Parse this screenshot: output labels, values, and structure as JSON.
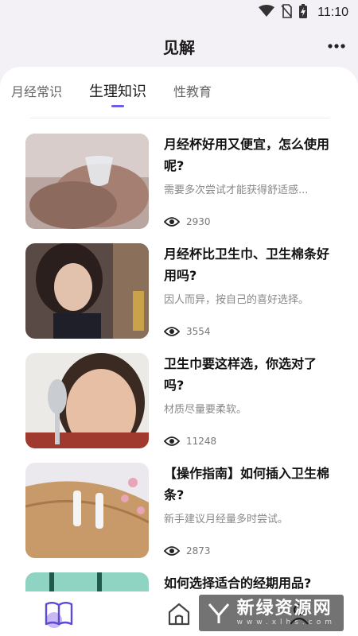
{
  "status_bar": {
    "time": "11:10"
  },
  "header": {
    "title": "见解",
    "more_icon": "more-dots-icon"
  },
  "tabs": [
    {
      "label": "月经常识",
      "active": false
    },
    {
      "label": "生理知识",
      "active": true
    },
    {
      "label": "性教育",
      "active": false
    }
  ],
  "articles": [
    {
      "title": "月经杯好用又便宜，怎么使用呢?",
      "subtitle": "需要多次尝试才能获得舒适感...",
      "views": "2930"
    },
    {
      "title": "月经杯比卫生巾、卫生棉条好用吗?",
      "subtitle": "因人而异，按自己的喜好选择。",
      "views": "3554"
    },
    {
      "title": "卫生巾要这样选，你选对了吗?",
      "subtitle": "材质尽量要柔软。",
      "views": "11248"
    },
    {
      "title": "【操作指南】如何插入卫生棉条?",
      "subtitle": "新手建议月经量多时尝试。",
      "views": "2873"
    },
    {
      "title": "如何选择适合的经期用品?",
      "subtitle": "",
      "views": ""
    }
  ],
  "bottom_nav": {
    "items": [
      "book-icon",
      "home-icon",
      "user-icon"
    ]
  },
  "watermark": {
    "text": "新绿资源网",
    "sub": "www.xlhs.com"
  },
  "colors": {
    "accent": "#6b5ce7",
    "background": "#f4f1f6"
  }
}
